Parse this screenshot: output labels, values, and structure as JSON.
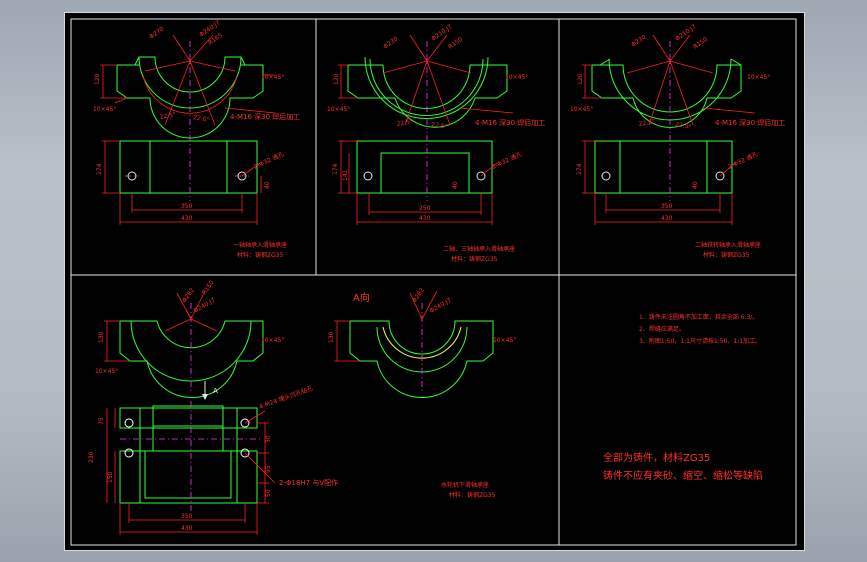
{
  "colors": {
    "outline": "#33ff33",
    "dimension": "#ff2020",
    "center": "#ff33ff",
    "frame": "#e6e6e6",
    "background": "#000000"
  },
  "panel1": {
    "dims": {
      "d1": "Φ270",
      "d2": "Φ240.J7",
      "d3": "R165",
      "height": "120",
      "chamfer_r": "10×45°",
      "chamfer_l": "10×45°",
      "ang1": "22.5°",
      "ang2": "22.0°",
      "holes": "4-M16 深30 焊后加工",
      "h2": "174",
      "hole2": "2-Φ32 通孔",
      "d40": "40",
      "w1": "350",
      "w2": "430"
    },
    "caption": {
      "line1": "一轴轴承入滑轴承座",
      "line2": "材料：铸钢ZG35"
    }
  },
  "panel2": {
    "dims": {
      "d1": "Φ230",
      "d2": "Φ210.J7",
      "d3": "R150",
      "height": "120",
      "chamfer_r": "10×45°",
      "chamfer_l": "10×45°",
      "ang1": "22.5°",
      "ang2": "22.5°",
      "holes": "4-M16 深30 焊后加工",
      "h2": "174",
      "h3": "141",
      "hole2": "2-Φ32 通孔",
      "d40": "40",
      "w1": "250",
      "w2": "430"
    },
    "caption": {
      "line1": "二轴、三轴轴承入滑轴承座",
      "line2": "材料：铸钢ZG35"
    }
  },
  "panel3": {
    "dims": {
      "d1": "Φ230",
      "d2": "Φ210.J7",
      "d3": "R150",
      "height": "120",
      "chamfer_r": "10×45°",
      "chamfer_l": "10×45°",
      "ang1": "22.5°",
      "ang2": "22.5°",
      "holes": "4-M16 深30 焊后加工",
      "h2": "174",
      "hole2": "2-Φ32 通孔",
      "d40": "40",
      "w1": "350",
      "w2": "430"
    },
    "caption": {
      "line1": "二轴铁转轴承入滑轴承座",
      "line2": "材料：铸钢ZG35"
    }
  },
  "panel4": {
    "dims": {
      "d1": "Φ282",
      "d2": "Φ240.J7",
      "d3": "R150",
      "height": "130",
      "chamfer_r": "10×45°",
      "chamfer_l": "10×45°",
      "arrow": "A",
      "holes": "4-M24 埋头沉孔钻孔",
      "h1": "75",
      "h2": "230",
      "h3": "150",
      "r1": "30",
      "r2": "95",
      "r3": "50",
      "hole2": "2-Φ18H7 与V配作",
      "w1": "350",
      "w2": "430"
    },
    "view_label": "A向",
    "section": {
      "d1": "Φ282",
      "d2": "Φ240.J7",
      "height": "130",
      "chamfer": "10×45°"
    },
    "caption": {
      "line1": "水轮机下滑轴承座",
      "line2": "材料：铸钢ZG35"
    }
  },
  "notes": {
    "items": [
      "1、铸件未注圆角不加工面，其余全部 6.3/。",
      "2、焊缝应满足。",
      "3、附图1:50，1:1尺寸请按1:50，1:1加工。"
    ],
    "main1": "全部为铸件，材料ZG35",
    "main2": "铸件不应有夹砂、缩空、缩松等缺陷"
  }
}
